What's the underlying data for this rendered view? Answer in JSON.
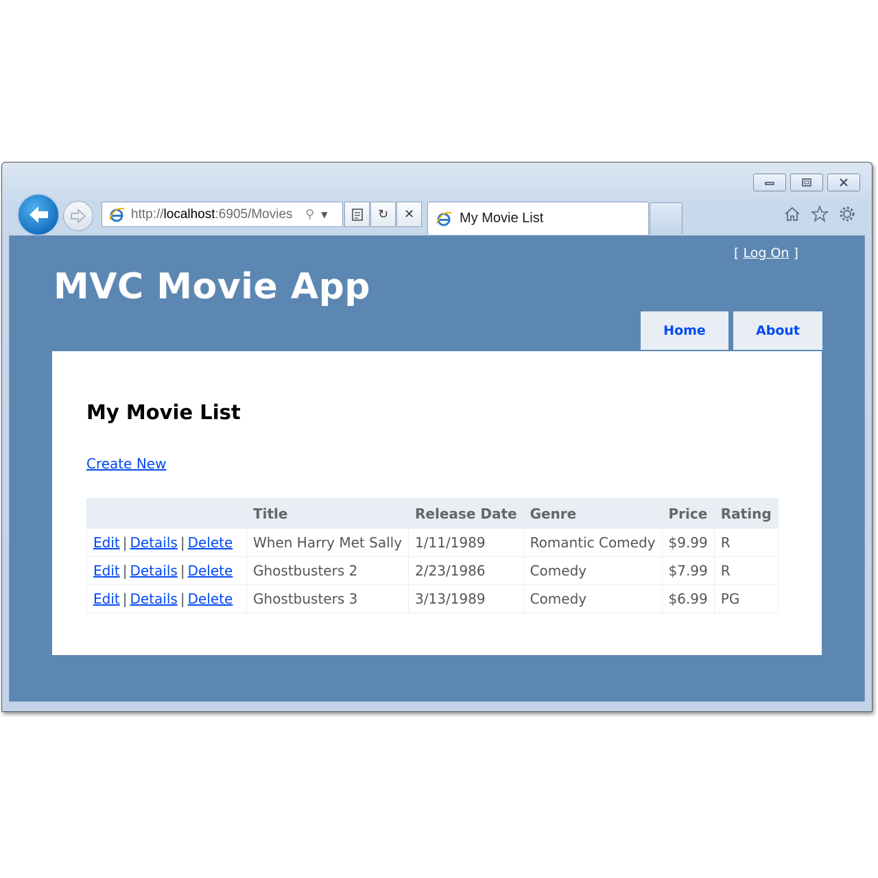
{
  "browser": {
    "address_url_prefix": "http://",
    "address_url_host": "localhost",
    "address_url_rest": ":6905/Movies",
    "tab_title": "My Movie List"
  },
  "header": {
    "logon_open": "[",
    "logon_label": "Log On",
    "logon_close": "]",
    "site_title": "MVC Movie App",
    "menu": [
      {
        "label": "Home"
      },
      {
        "label": "About"
      }
    ]
  },
  "main": {
    "heading": "My Movie List",
    "create_link": "Create New",
    "table": {
      "columns": [
        "",
        "Title",
        "Release Date",
        "Genre",
        "Price",
        "Rating"
      ],
      "actions": {
        "edit": "Edit",
        "details": "Details",
        "delete": "Delete",
        "separator": "|"
      },
      "rows": [
        {
          "title": "When Harry Met Sally",
          "release_date": "1/11/1989",
          "genre": "Romantic Comedy",
          "price": "$9.99",
          "rating": "R"
        },
        {
          "title": "Ghostbusters 2",
          "release_date": "2/23/1986",
          "genre": "Comedy",
          "price": "$7.99",
          "rating": "R"
        },
        {
          "title": "Ghostbusters 3",
          "release_date": "3/13/1989",
          "genre": "Comedy",
          "price": "$6.99",
          "rating": "PG"
        }
      ]
    }
  },
  "colors": {
    "page_background": "#5c87b2",
    "link": "#034af3",
    "header_cell": "#e8eef4"
  },
  "icons": [
    "back-arrow-icon",
    "forward-arrow-icon",
    "ie-logo-icon",
    "search-icon",
    "dropdown-icon",
    "compatibility-icon",
    "refresh-icon",
    "stop-icon",
    "home-icon",
    "favorites-star-icon",
    "settings-gear-icon"
  ]
}
